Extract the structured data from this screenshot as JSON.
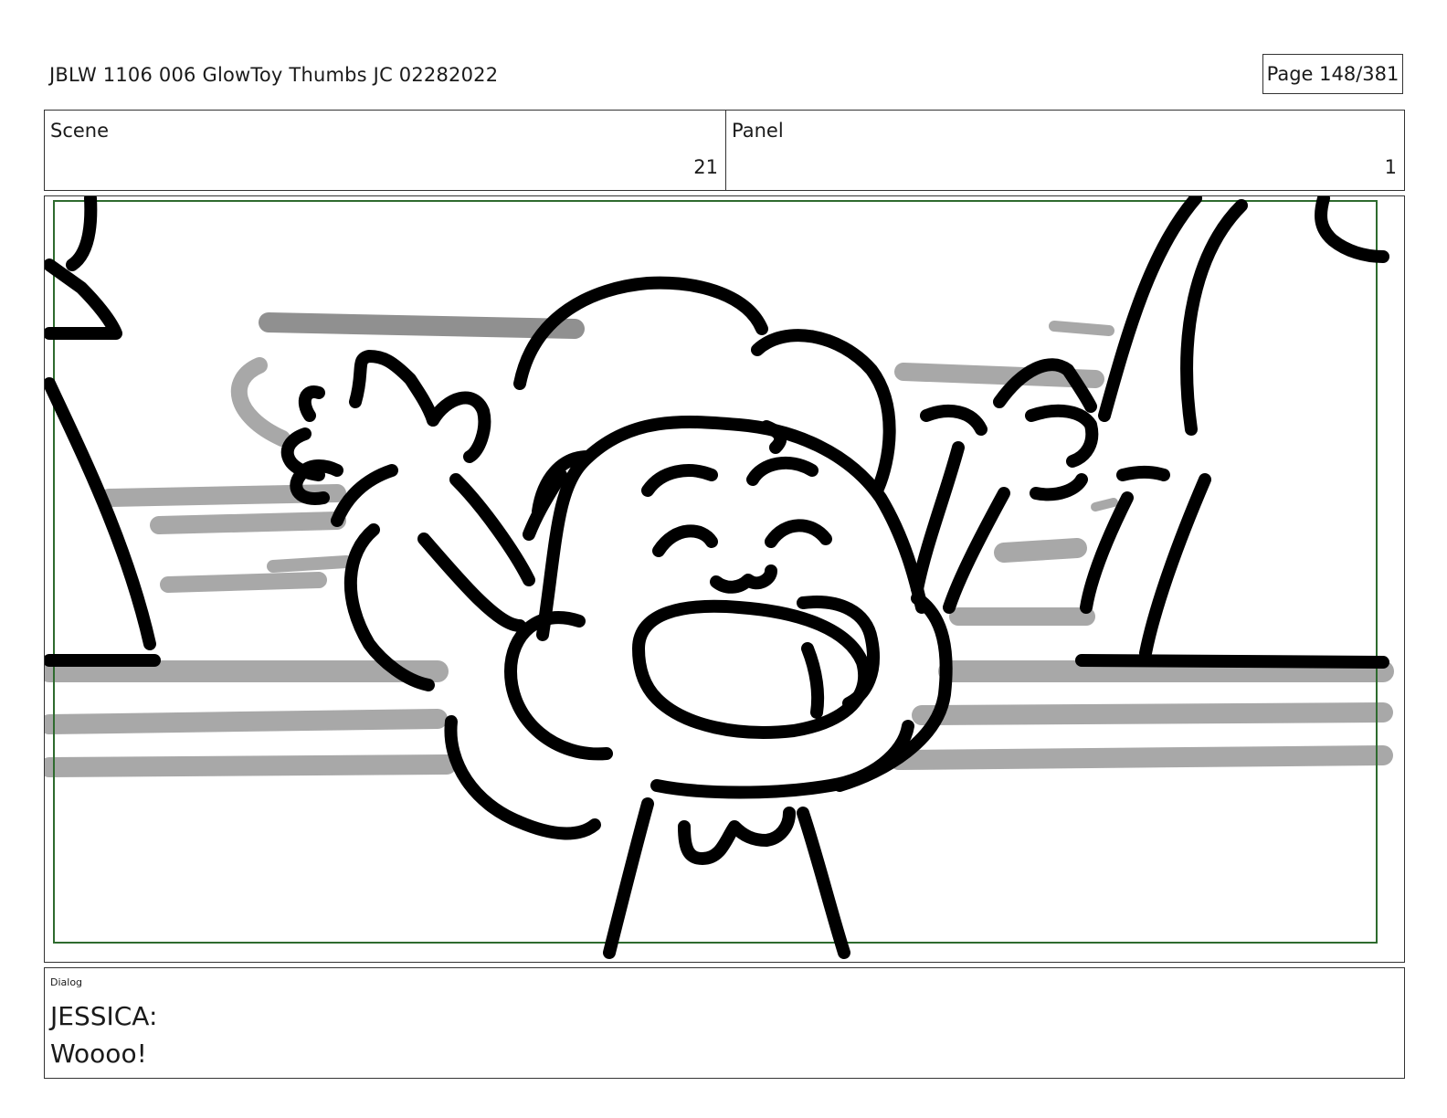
{
  "header": {
    "title": "JBLW 1106 006 GlowToy Thumbs JC 02282022",
    "page": "Page 148/381"
  },
  "info": {
    "scene_label": "Scene",
    "scene_value": "21",
    "panel_label": "Panel",
    "panel_value": "1"
  },
  "artwork": {
    "subject": "storyboard-sketch",
    "safe_frame_color": "#2e6b2e",
    "line_color": "#000000",
    "tone_color": "#a8a8a8"
  },
  "dialog": {
    "label": "Dialog",
    "speaker": "JESSICA:",
    "line": "Woooo!"
  }
}
